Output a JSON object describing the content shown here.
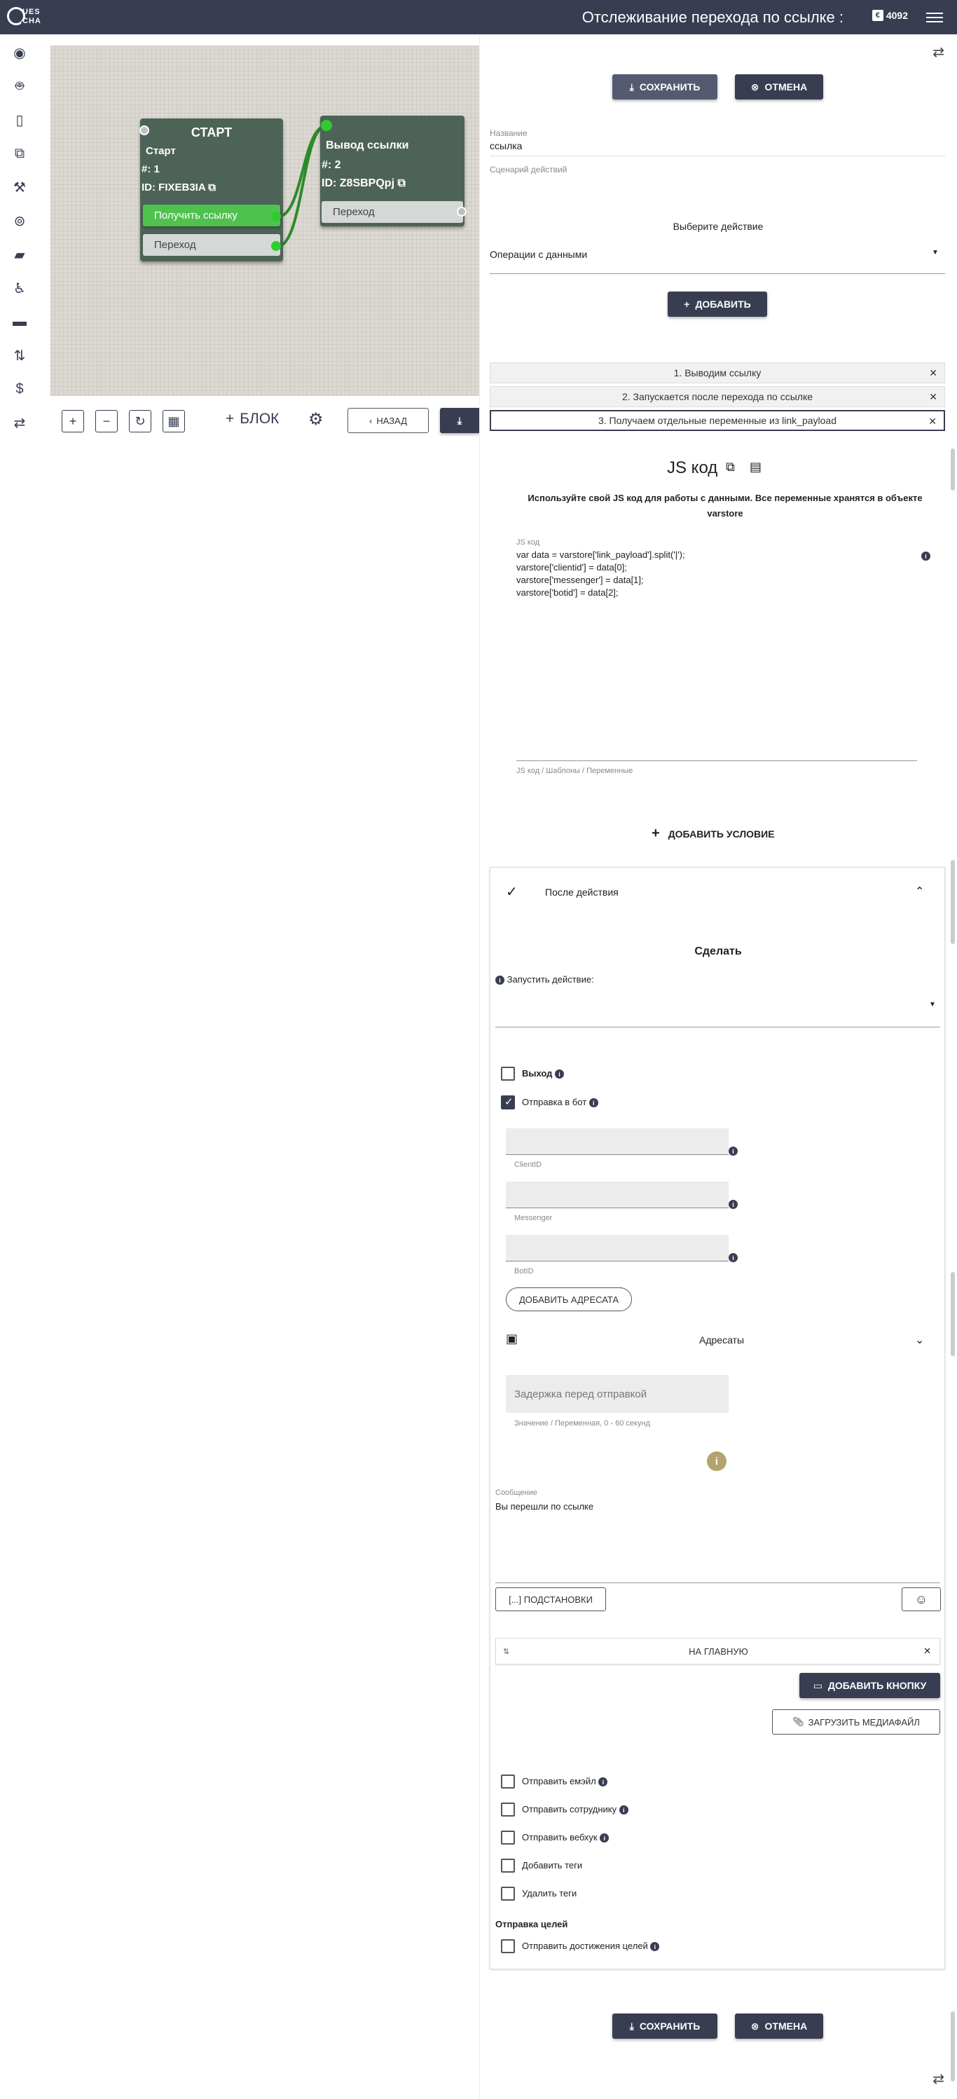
{
  "header": {
    "logo_top": "UES",
    "logo_bottom": "CHA",
    "title": "Отслеживание перехода по ссылке :",
    "credits": "4092"
  },
  "sidebar": {
    "icons": [
      "palette-icon",
      "robot-icon",
      "phone-icon",
      "flow-icon",
      "tools-icon",
      "target-icon",
      "chat-icon",
      "accessibility-icon",
      "card-icon",
      "routing-icon",
      "dollar-icon",
      "swap-icon"
    ]
  },
  "canvas": {
    "node1": {
      "header": "СТАРТ",
      "name": "Старт",
      "number": "#: 1",
      "id": "ID: FIXEB3IA",
      "button": "Получить ссылку",
      "output": "Переход"
    },
    "node2": {
      "name": "Вывод ссылки",
      "number": "#: 2",
      "id": "ID: Z8SBPQpj",
      "output": "Переход"
    },
    "toolbar": {
      "zoom_in": "+",
      "zoom_out": "−",
      "block": "БЛОК",
      "back": "НАЗАД"
    }
  },
  "panel": {
    "save": "СОХРАНИТЬ",
    "cancel": "ОТМЕНА",
    "name_label": "Название",
    "name_value": "ссылка",
    "scenario_label": "Сценарий действий",
    "choose_action": "Выберите действие",
    "action_select": "Операции с данными",
    "add": "ДОБАВИТЬ",
    "steps": [
      "1. Выводим ссылку",
      "2. Запускается после перехода по ссылке",
      "3. Получаем отдельные переменные из link_payload"
    ],
    "js_title": "JS код",
    "js_desc": "Используйте свой JS код для работы с данными. Все переменные хранятся в объекте varstore",
    "js_label": "JS код",
    "js_lines": [
      "var data = varstore['link_payload'].split('|');",
      "varstore['clientid'] = data[0];",
      "varstore['messenger'] = data[1];",
      "varstore['botid'] = data[2];"
    ],
    "js_hint": "JS код / Шаблоны / Переменные",
    "add_condition": "ДОБАВИТЬ УСЛОВИЕ",
    "after_action": "После действия",
    "do": "Сделать",
    "run_action": "Запустить действие:",
    "exit": "Выход",
    "send_bot": "Отправка в бот",
    "f_client": "ClientID",
    "f_messenger": "Messenger",
    "f_bot": "BotID",
    "add_recipients": "ДОБАВИТЬ АДРЕСАТА",
    "recipients": "Адресаты",
    "delay_placeholder": "Задержка перед отправкой",
    "delay_hint": "Значение / Переменная, 0 - 60 секунд",
    "message_label": "Сообщение",
    "message_value": "Вы перешли по ссылке",
    "substitutions": "[...] ПОДСТАНОВКИ",
    "home_button": "НА ГЛАВНУЮ",
    "add_button": "ДОБАВИТЬ КНОПКУ",
    "upload_media": "ЗАГРУЗИТЬ МЕДИАФАЙЛ",
    "send_email": "Отправить емэйл",
    "send_employee": "Отправить сотруднику",
    "send_webhook": "Отправить вебхук",
    "add_tags": "Добавить теги",
    "remove_tags": "Удалить теги",
    "goals_title": "Отправка целей",
    "send_goals": "Отправить достижения целей"
  },
  "colors": {
    "primary": "#383d52",
    "node": "#4e6358",
    "green": "#4fc24d"
  }
}
